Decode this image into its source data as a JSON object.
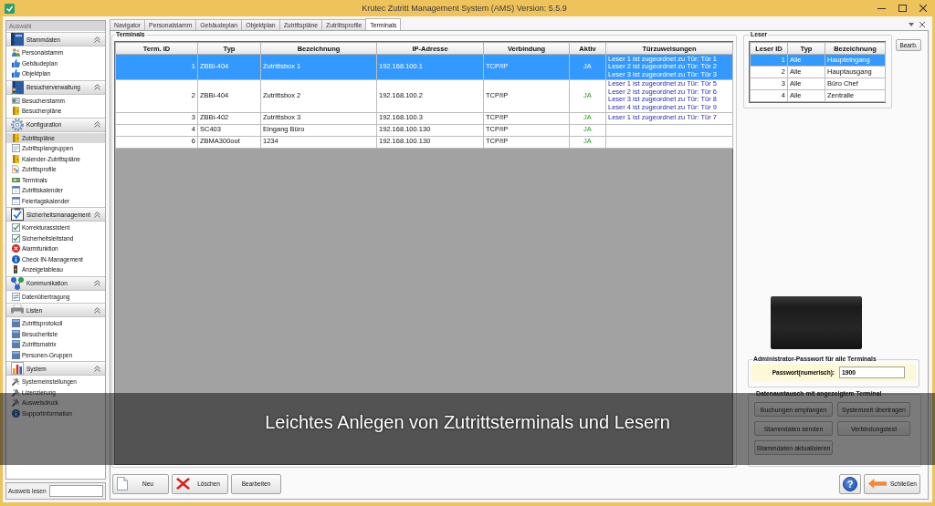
{
  "window": {
    "title": "Krutec Zutritt Management System (AMS) Version: 5.5.9"
  },
  "sidebar": {
    "header": "Auswahl",
    "groups": [
      {
        "title": "Stammdaten",
        "expanded": true,
        "items": [
          {
            "label": "Personalstamm",
            "selected": false
          },
          {
            "label": "Gebäudeplan",
            "selected": false
          },
          {
            "label": "Objektplan",
            "selected": false
          }
        ]
      },
      {
        "title": "Besucherverwaltung",
        "expanded": true,
        "items": [
          {
            "label": "Besucherstamm",
            "selected": false
          },
          {
            "label": "Besucherpläne",
            "selected": false
          }
        ]
      },
      {
        "title": "Konfiguration",
        "expanded": true,
        "items": [
          {
            "label": "Zutrittspläne",
            "selected": true
          },
          {
            "label": "Zutrittsplangruppen",
            "selected": false
          },
          {
            "label": "Kalender-Zutrittspläne",
            "selected": false
          },
          {
            "label": "Zutrittsprofile",
            "selected": false
          },
          {
            "label": "Terminals",
            "selected": false
          },
          {
            "label": "Zutrittskalender",
            "selected": false
          },
          {
            "label": "Feiertagskalender",
            "selected": false
          }
        ]
      },
      {
        "title": "Sicherheitsmanagement",
        "expanded": true,
        "items": [
          {
            "label": "Korrekturassistent",
            "selected": false
          },
          {
            "label": "Sicherheitsleitstand",
            "selected": false
          },
          {
            "label": "Alarmfunktion",
            "selected": false
          },
          {
            "label": "Check IN-Management",
            "selected": false
          },
          {
            "label": "Anzeigetableau",
            "selected": false
          }
        ]
      },
      {
        "title": "Kommunikation",
        "expanded": true,
        "items": [
          {
            "label": "Datenübertragung",
            "selected": false
          }
        ]
      },
      {
        "title": "Listen",
        "expanded": true,
        "items": [
          {
            "label": "Zutrittsprotokoll",
            "selected": false
          },
          {
            "label": "Besucherliste",
            "selected": false
          },
          {
            "label": "Zutrittsmatrix",
            "selected": false
          },
          {
            "label": "Personen-Gruppen",
            "selected": false
          }
        ]
      },
      {
        "title": "System",
        "expanded": true,
        "items": [
          {
            "label": "Systemeinstellungen",
            "selected": false
          },
          {
            "label": "Lizenzierung",
            "selected": false
          },
          {
            "label": "Ausweisdruck",
            "selected": false
          },
          {
            "label": "Supportinformation",
            "selected": false
          }
        ]
      }
    ],
    "card_reader": {
      "label": "Ausweis lesen"
    }
  },
  "tabs": [
    {
      "label": "Navigator",
      "selected": false
    },
    {
      "label": "Personalstamm",
      "selected": false
    },
    {
      "label": "Gebäudeplan",
      "selected": false
    },
    {
      "label": "Objektplan",
      "selected": false
    },
    {
      "label": "Zutrittspläne",
      "selected": false
    },
    {
      "label": "Zutrittsprofile",
      "selected": false
    },
    {
      "label": "Terminals",
      "selected": true
    }
  ],
  "terminals": {
    "title": "Terminals",
    "columns": [
      "Term. ID",
      "Typ",
      "Bezeichnung",
      "IP-Adresse",
      "Verbindung",
      "Aktiv",
      "Türzuweisungen"
    ],
    "rows": [
      {
        "cells": [
          "1",
          "ZBBi-404",
          "Zutrittsbox 1",
          "192.168.100.1",
          "TCP/IP",
          "JA"
        ],
        "doors": [
          "Leser 1 ist zugeordnet zu Tür: Tür 1",
          "Leser 2 ist zugeordnet zu Tür: Tür 2",
          "Leser 3 ist zugeordnet zu Tür: Tür 3"
        ],
        "selected": true
      },
      {
        "cells": [
          "2",
          "ZBBi-404",
          "Zutrittsbox 2",
          "192.168.100.2",
          "TCP/IP",
          "JA"
        ],
        "doors": [
          "Leser 1 ist zugeordnet zu Tür: Tür 5",
          "Leser 2 ist zugeordnet zu Tür: Tür 6",
          "Leser 3 ist zugeordnet zu Tür: Tür 8",
          "Leser 4 ist zugeordnet zu Tür: Tür 9"
        ],
        "selected": false
      },
      {
        "cells": [
          "3",
          "ZBBi-402",
          "Zutrittsbox 3",
          "192.168.100.3",
          "TCP/IP",
          "JA"
        ],
        "doors": [
          "Leser 1 ist zugeordnet zu Tür: Tür 7"
        ],
        "selected": false
      },
      {
        "cells": [
          "4",
          "SC403",
          "Eingang Büro",
          "192.168.100.130",
          "TCP/IP",
          "JA"
        ],
        "selected": false
      },
      {
        "cells": [
          "6",
          "ZBMA300out",
          "1234",
          "192.168.100.130",
          "TCP/IP",
          "JA"
        ],
        "selected": false
      }
    ]
  },
  "readers": {
    "title": "Leser",
    "columns": [
      "Leser ID",
      "Typ",
      "Bezeichnung"
    ],
    "rows": [
      {
        "cells": [
          "1",
          "Alle",
          "Haupteingang"
        ],
        "selected": true
      },
      {
        "cells": [
          "2",
          "Alle",
          "Hauptausgang"
        ],
        "selected": false
      },
      {
        "cells": [
          "3",
          "Alle",
          "Büro Chef"
        ],
        "selected": false
      },
      {
        "cells": [
          "4",
          "Alle",
          "Zentralle"
        ],
        "selected": false
      }
    ],
    "edit_button": "Bearb."
  },
  "admin_password": {
    "title": "Administrator-Passwort für alle Terminals",
    "label": "Passwort(numerisch):",
    "value": "1900"
  },
  "data_exchange": {
    "title": "Datenaustausch mit angezeigtem Terminal",
    "buttons": [
      "Buchungen empfangen",
      "Systemzeit übertragen",
      "Stammdaten senden",
      "Verbindungstest",
      "Stammdaten aktualisieren"
    ]
  },
  "footer": {
    "buttons": [
      {
        "label": "Neu",
        "kind": "new"
      },
      {
        "label": "Löschen",
        "kind": "delete"
      },
      {
        "label": "Bearbeiten",
        "kind": "plain"
      }
    ],
    "help_button": "?",
    "close_button": "Schließen"
  },
  "caption_banner": {
    "text": "Leichtes Anlegen von Zutrittsterminals und Lesern"
  }
}
